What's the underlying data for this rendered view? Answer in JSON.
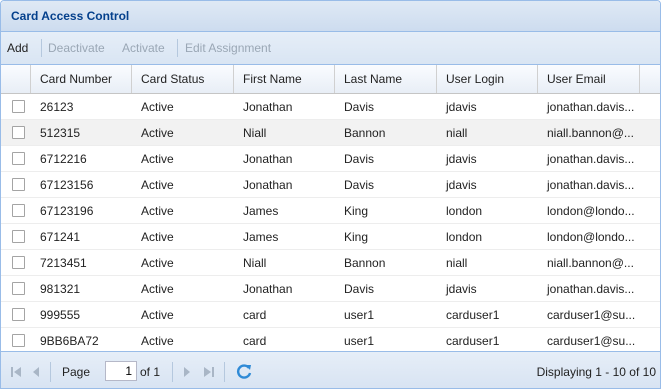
{
  "panel": {
    "title": "Card Access Control"
  },
  "toolbar": {
    "add": "Add",
    "deactivate": "Deactivate",
    "activate": "Activate",
    "edit_assignment": "Edit Assignment"
  },
  "grid": {
    "columns": [
      "Card Number",
      "Card Status",
      "First Name",
      "Last Name",
      "User Login",
      "User Email"
    ],
    "rows": [
      {
        "card": "26123",
        "status": "Active",
        "first": "Jonathan",
        "last": "Davis",
        "login": "jdavis",
        "email": "jonathan.davis..."
      },
      {
        "card": "512315",
        "status": "Active",
        "first": "Niall",
        "last": "Bannon",
        "login": "niall",
        "email": "niall.bannon@..."
      },
      {
        "card": "6712216",
        "status": "Active",
        "first": "Jonathan",
        "last": "Davis",
        "login": "jdavis",
        "email": "jonathan.davis..."
      },
      {
        "card": "67123156",
        "status": "Active",
        "first": "Jonathan",
        "last": "Davis",
        "login": "jdavis",
        "email": "jonathan.davis..."
      },
      {
        "card": "67123196",
        "status": "Active",
        "first": "James",
        "last": "King",
        "login": "london",
        "email": "london@londo..."
      },
      {
        "card": "671241",
        "status": "Active",
        "first": "James",
        "last": "King",
        "login": "london",
        "email": "london@londo..."
      },
      {
        "card": "7213451",
        "status": "Active",
        "first": "Niall",
        "last": "Bannon",
        "login": "niall",
        "email": "niall.bannon@..."
      },
      {
        "card": "981321",
        "status": "Active",
        "first": "Jonathan",
        "last": "Davis",
        "login": "jdavis",
        "email": "jonathan.davis..."
      },
      {
        "card": "999555",
        "status": "Active",
        "first": "card",
        "last": "user1",
        "login": "carduser1",
        "email": "carduser1@su..."
      },
      {
        "card": "9BB6BA72",
        "status": "Active",
        "first": "card",
        "last": "user1",
        "login": "carduser1",
        "email": "carduser1@su..."
      }
    ]
  },
  "pager": {
    "page_label": "Page",
    "page_value": "1",
    "of_label": "of 1",
    "display_text": "Displaying 1 - 10 of 10"
  },
  "colors": {
    "accent": "#99bce8",
    "title_text": "#04408c",
    "refresh": "#2f8ad6"
  },
  "icons": [
    "first-page-icon",
    "prev-page-icon",
    "next-page-icon",
    "last-page-icon",
    "refresh-icon"
  ]
}
